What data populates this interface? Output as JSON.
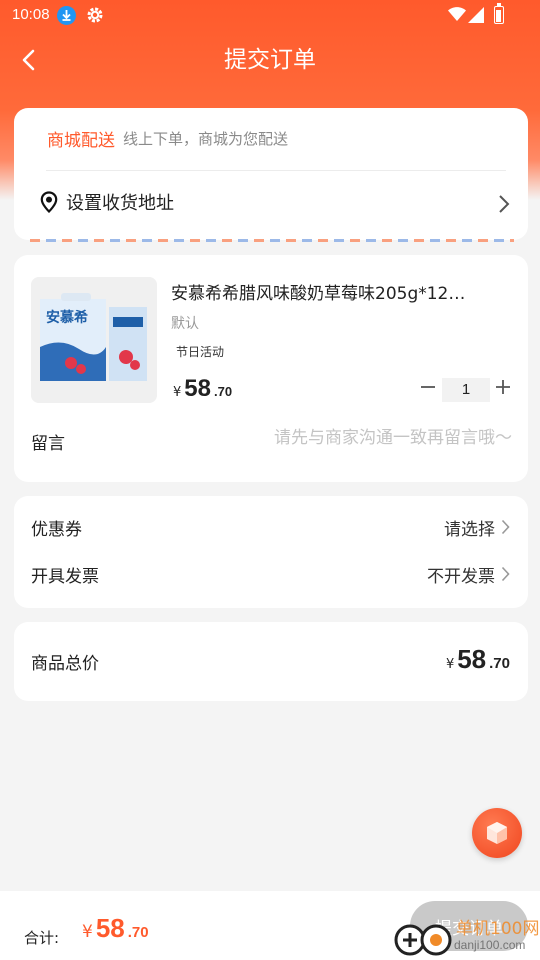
{
  "status_bar": {
    "time": "10:08"
  },
  "header": {
    "title": "提交订单"
  },
  "address": {
    "delivery_tag": "商城配送",
    "delivery_desc": "线上下单，商城为您配送",
    "set_address_label": "设置收货地址"
  },
  "product": {
    "name": "安慕希希腊风味酸奶草莓味205g*12…",
    "spec": "默认",
    "tag": "节日活动",
    "image_brand_text": "安慕希",
    "price_currency": "¥",
    "price_int": "58",
    "price_dec": ".70",
    "quantity": "1"
  },
  "message": {
    "label": "留言",
    "placeholder": "请先与商家沟通一致再留言哦～"
  },
  "options": {
    "coupon_label": "优惠券",
    "coupon_value": "请选择",
    "invoice_label": "开具发票",
    "invoice_value": "不开发票"
  },
  "total": {
    "label": "商品总价",
    "currency": "¥",
    "int": "58",
    "dec": ".70"
  },
  "bottom_bar": {
    "label": "合计:",
    "currency": "¥",
    "int": "58",
    "dec": ".70",
    "submit_label": "提交订单"
  },
  "watermark": {
    "text": "单机100网",
    "url": "danji100.com"
  },
  "colors": {
    "accent": "#ff5a2c",
    "submit_disabled": "#c9c9c9",
    "background": "#f4f4f4"
  }
}
